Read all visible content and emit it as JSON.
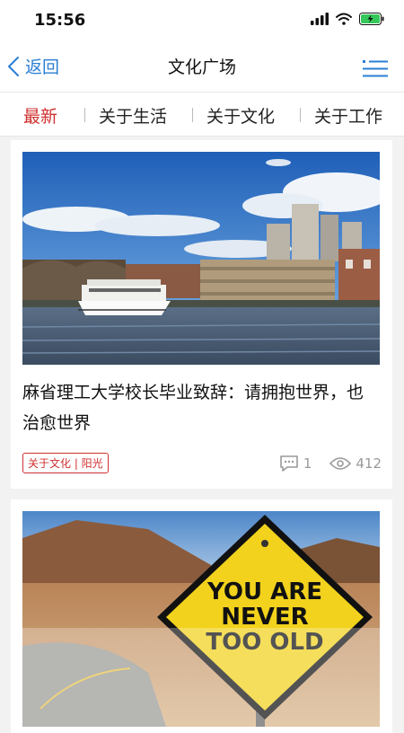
{
  "status_bar": {
    "time": "15:56"
  },
  "nav": {
    "back_label": "返回",
    "title": "文化广场"
  },
  "tabs": [
    {
      "label": "最新",
      "active": true
    },
    {
      "label": "关于生活",
      "active": false
    },
    {
      "label": "关于文化",
      "active": false
    },
    {
      "label": "关于工作",
      "active": false
    }
  ],
  "articles": [
    {
      "title": "麻省理工大学校长毕业致辞：请拥抱世界，也治愈世界",
      "tag": "关于文化 | 阳光",
      "comments": "1",
      "views": "412"
    },
    {
      "sign_text_line1": "YOU ARE",
      "sign_text_line2": "NEVER",
      "sign_text_line3": "TOO OLD"
    }
  ],
  "colors": {
    "accent": "#d0302f",
    "link": "#2a7fd4"
  }
}
